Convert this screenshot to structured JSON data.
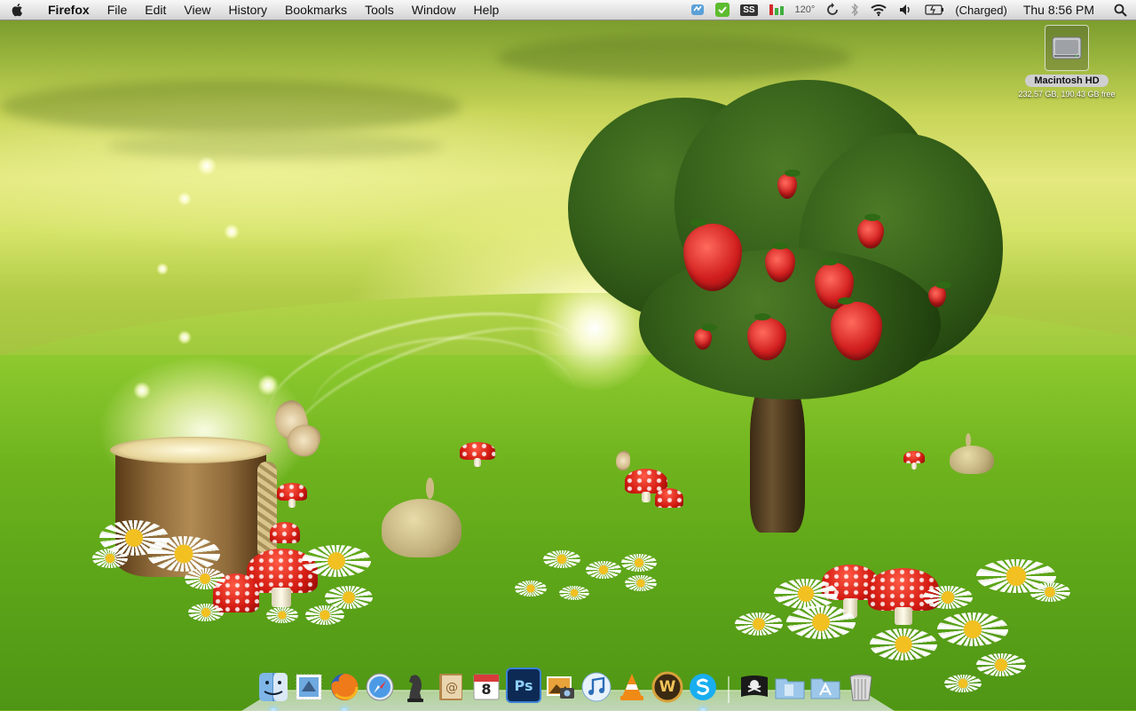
{
  "menubar": {
    "app_name": "Firefox",
    "menus": [
      "File",
      "Edit",
      "View",
      "History",
      "Bookmarks",
      "Tools",
      "Window",
      "Help"
    ],
    "status": {
      "ss_label": "SS",
      "temperature": "120°",
      "battery": "(Charged)",
      "clock": "Thu 8:56 PM"
    }
  },
  "desktop": {
    "drive": {
      "label": "Macintosh HD",
      "info": "232.57 GB, 190.43 GB free"
    }
  },
  "dock": {
    "items": [
      {
        "name": "finder",
        "icon": "finder-icon",
        "running": true
      },
      {
        "name": "mail",
        "icon": "mail-stamp-icon",
        "running": false
      },
      {
        "name": "firefox",
        "icon": "firefox-icon",
        "running": true
      },
      {
        "name": "safari",
        "icon": "safari-compass-icon",
        "running": false
      },
      {
        "name": "chess",
        "icon": "chess-knight-icon",
        "running": false
      },
      {
        "name": "address-book",
        "icon": "address-book-icon",
        "running": false
      },
      {
        "name": "ical",
        "icon": "calendar-icon",
        "running": false,
        "day": "8"
      },
      {
        "name": "photoshop",
        "icon": "photoshop-icon",
        "running": false,
        "text": "Ps"
      },
      {
        "name": "iphoto",
        "icon": "iphoto-icon",
        "running": false
      },
      {
        "name": "itunes",
        "icon": "itunes-icon",
        "running": false
      },
      {
        "name": "vlc",
        "icon": "vlc-cone-icon",
        "running": false
      },
      {
        "name": "world-of-warcraft",
        "icon": "wow-icon",
        "running": false,
        "text": "W"
      },
      {
        "name": "skype",
        "icon": "skype-icon",
        "running": true
      },
      {
        "name": "pirate",
        "icon": "pirate-flag-icon",
        "running": false
      },
      {
        "name": "documents",
        "icon": "documents-folder-icon",
        "running": false
      },
      {
        "name": "applications",
        "icon": "applications-folder-icon",
        "running": false
      },
      {
        "name": "trash",
        "icon": "trash-icon",
        "running": false
      }
    ]
  }
}
